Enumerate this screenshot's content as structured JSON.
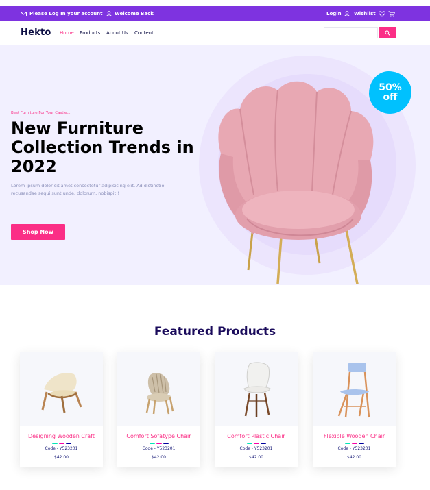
{
  "topbar": {
    "login_prompt": "Please Log In your account",
    "welcome": "Welcome Back",
    "login": "Login",
    "wishlist": "Wishlist"
  },
  "nav": {
    "logo": "Hekto",
    "links": [
      "Home",
      "Products",
      "About Us",
      "Content"
    ],
    "active_link": "Home",
    "search_placeholder": ""
  },
  "hero": {
    "tagline": "Best Furniture For Your Castle....",
    "title": "New Furniture Collection Trends in 2022",
    "description": "Lorem ipsum dolor sit amet consectetur adipisicing elit. Ad distinctio recusandae sequi sunt unde, dolorum, nobispit !",
    "cta": "Shop Now",
    "badge_percent": "50%",
    "badge_off": "off"
  },
  "featured": {
    "title": "Featured Products",
    "products": [
      {
        "name": "Designing Wooden Craft",
        "code": "Code - Y523201",
        "price": "$42.00",
        "icon": "lounge-chair-icon"
      },
      {
        "name": "Comfort Sofatype Chair",
        "code": "Code - Y523201",
        "price": "$42.00",
        "icon": "armchair-icon"
      },
      {
        "name": "Comfort Plastic Chair",
        "code": "Code - Y523201",
        "price": "$42.00",
        "icon": "plastic-chair-icon"
      },
      {
        "name": "Flexible Wooden Chair",
        "code": "Code - Y523201",
        "price": "$42.00",
        "icon": "wooden-chair-icon"
      }
    ],
    "swatch_colors": [
      "#05e6b7",
      "#f701a8",
      "#00009d"
    ]
  },
  "colors": {
    "purple": "#7e33e0",
    "pink": "#fb2e86",
    "navy": "#151875",
    "hero_bg": "#f2f0ff",
    "badge": "#00c1fe"
  }
}
